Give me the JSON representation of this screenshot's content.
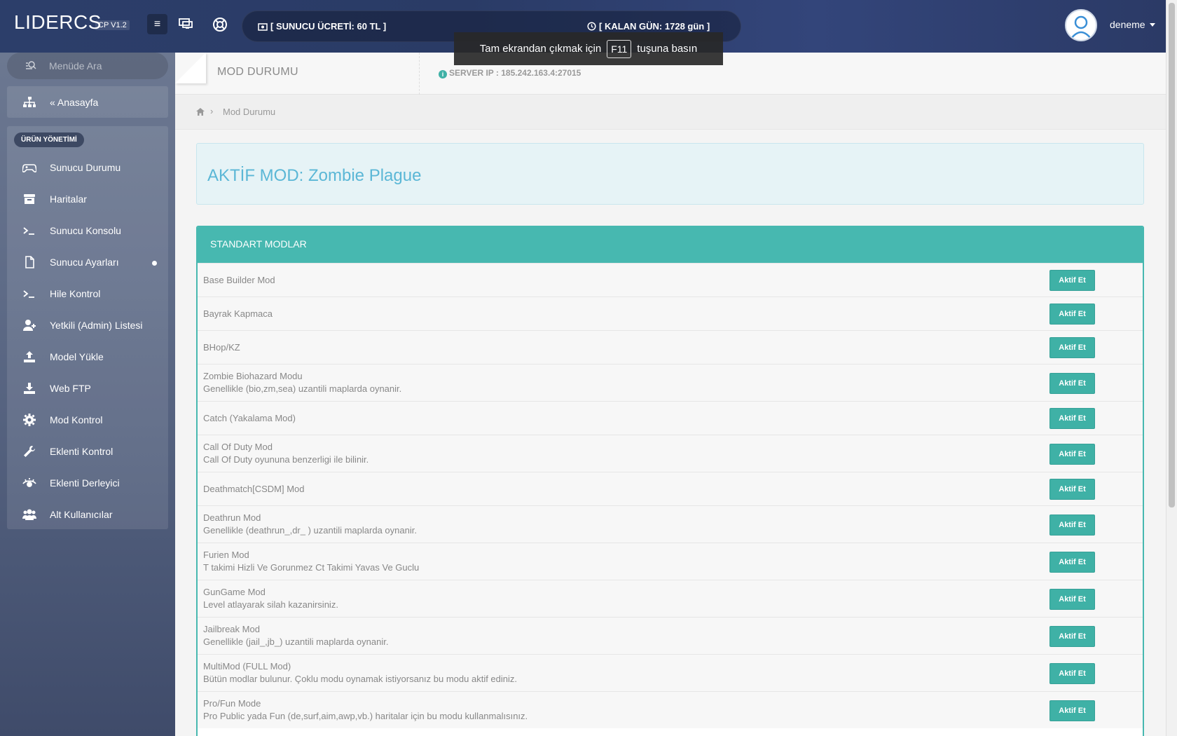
{
  "header": {
    "logo": "LIDERCS",
    "version": "CP V1.2",
    "fee": "[ SUNUCU ÜCRETİ: 60 TL ]",
    "remaining": "[ KALAN GÜN: 1728 gün ]",
    "username": "deneme"
  },
  "toast": {
    "before": "Tam ekrandan çıkmak için",
    "key": "F11",
    "after": "tuşuna basın"
  },
  "sidebar": {
    "search_placeholder": "Menüde Ara",
    "home": "« Anasayfa",
    "section": "ÜRÜN YÖNETİMİ",
    "items": [
      {
        "label": "Sunucu Durumu",
        "icon": "gamepad-icon"
      },
      {
        "label": "Haritalar",
        "icon": "archive-icon"
      },
      {
        "label": "Sunucu Konsolu",
        "icon": "terminal-icon"
      },
      {
        "label": "Sunucu Ayarları",
        "icon": "file-icon"
      },
      {
        "label": "Hile Kontrol",
        "icon": "terminal-icon"
      },
      {
        "label": "Yetkili (Admin) Listesi",
        "icon": "user-plus-icon"
      },
      {
        "label": "Model Yükle",
        "icon": "upload-icon"
      },
      {
        "label": "Web FTP",
        "icon": "download-icon"
      },
      {
        "label": "Mod Kontrol",
        "icon": "gear-icon"
      },
      {
        "label": "Eklenti Kontrol",
        "icon": "wrench-icon"
      },
      {
        "label": "Eklenti Derleyici",
        "icon": "eye-icon"
      },
      {
        "label": "Alt Kullanıcılar",
        "icon": "users-icon"
      }
    ]
  },
  "page": {
    "title": "MOD DURUMU",
    "server_ip": "SERVER IP : 185.242.163.4:27015",
    "breadcrumb": "Mod Durumu",
    "active_mod": "AKTİF MOD: Zombie Plague",
    "panel_title": "STANDART MODLAR",
    "button_label": "Aktif Et",
    "mods": [
      {
        "name": "Base Builder Mod",
        "desc": ""
      },
      {
        "name": "Bayrak Kapmaca",
        "desc": ""
      },
      {
        "name": "BHop/KZ",
        "desc": ""
      },
      {
        "name": "Zombie Biohazard Modu",
        "desc": "Genellikle (bio,zm,sea) uzantili maplarda oynanir."
      },
      {
        "name": "Catch (Yakalama Mod)",
        "desc": ""
      },
      {
        "name": "Call Of Duty Mod",
        "desc": "Call Of Duty oyununa benzerligi ile bilinir."
      },
      {
        "name": "Deathmatch[CSDM] Mod",
        "desc": ""
      },
      {
        "name": "Deathrun Mod",
        "desc": "Genellikle (deathrun_,dr_ ) uzantili maplarda oynanir."
      },
      {
        "name": "Furien Mod",
        "desc": "T takimi Hizli Ve Gorunmez Ct Takimi Yavas Ve Guclu"
      },
      {
        "name": "GunGame Mod",
        "desc": "Level atlayarak silah kazanirsiniz."
      },
      {
        "name": "Jailbreak Mod",
        "desc": "Genellikle (jail_,jb_) uzantili maplarda oynanir."
      },
      {
        "name": "MultiMod (FULL Mod)",
        "desc": "Bütün modlar bulunur. Çoklu modu oynamak istiyorsanız bu modu aktif ediniz."
      },
      {
        "name": "Pro/Fun Mode",
        "desc": "Pro Public yada Fun (de,surf,aim,awp,vb.) haritalar için bu modu kullanmalısınız."
      }
    ]
  }
}
